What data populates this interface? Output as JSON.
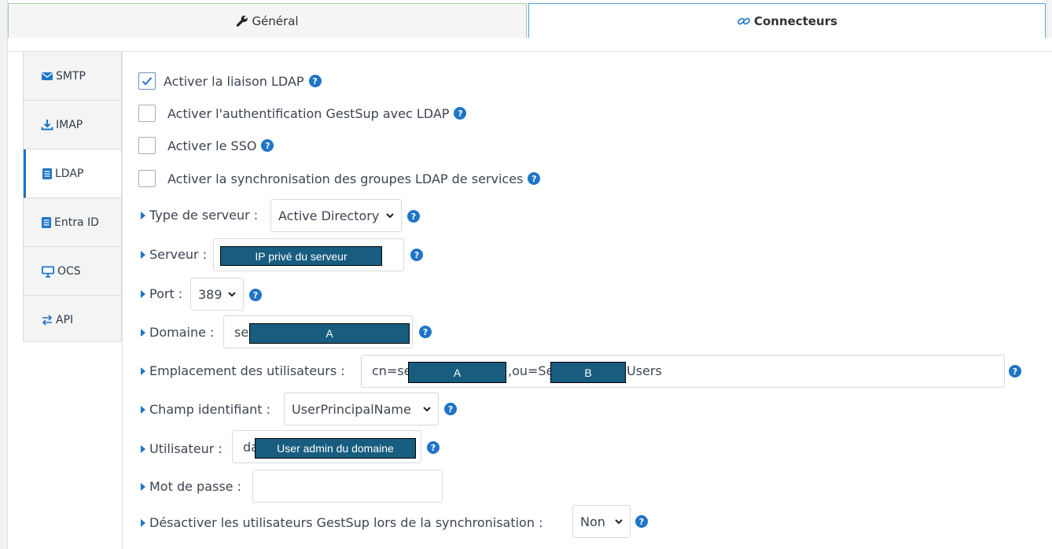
{
  "tabs": [
    {
      "label": "Général",
      "icon": "wrench-icon"
    },
    {
      "label": "Connecteurs",
      "icon": "link-icon"
    }
  ],
  "sidebar": {
    "items": [
      {
        "label": "SMTP",
        "icon": "envelope-icon"
      },
      {
        "label": "IMAP",
        "icon": "download-icon"
      },
      {
        "label": "LDAP",
        "icon": "book-icon",
        "active": true
      },
      {
        "label": "Entra ID",
        "icon": "book-icon"
      },
      {
        "label": "OCS",
        "icon": "desktop-icon"
      },
      {
        "label": "API",
        "icon": "exchange-icon"
      }
    ]
  },
  "checkboxes": [
    {
      "label": "Activer la liaison LDAP",
      "checked": true
    },
    {
      "label": "Activer l'authentification GestSup avec LDAP",
      "checked": false
    },
    {
      "label": "Activer le SSO",
      "checked": false
    },
    {
      "label": "Activer la synchronisation des groupes LDAP de services",
      "checked": false
    }
  ],
  "fields": {
    "server_type": {
      "label": "Type de serveur :",
      "value": "Active Directory"
    },
    "server": {
      "label": "Serveur :",
      "mask": "IP privé du serveur"
    },
    "port": {
      "label": "Port :",
      "value": "389"
    },
    "domain": {
      "label": "Domaine :",
      "value_prefix": "se",
      "mask": "A"
    },
    "user_location": {
      "label": "Emplacement des utilisateurs :",
      "value_prefix": "cn=se",
      "middle": ",ou=Se",
      "suffix": "Users",
      "mask_a": "A",
      "mask_b": "B"
    },
    "identifier_field": {
      "label": "Champ identifiant :",
      "value": "UserPrincipalName"
    },
    "user": {
      "label": "Utilisateur :",
      "value_prefix": "da",
      "mask": "User admin du domaine"
    },
    "password": {
      "label": "Mot de passe :",
      "value": ""
    },
    "disable_users": {
      "label": "Désactiver les utilisateurs GestSup lors de la synchronisation :",
      "value": "Non"
    }
  },
  "help_symbol": "?",
  "colors": {
    "accent": "#1f74c6",
    "mask": "#185d7f"
  }
}
